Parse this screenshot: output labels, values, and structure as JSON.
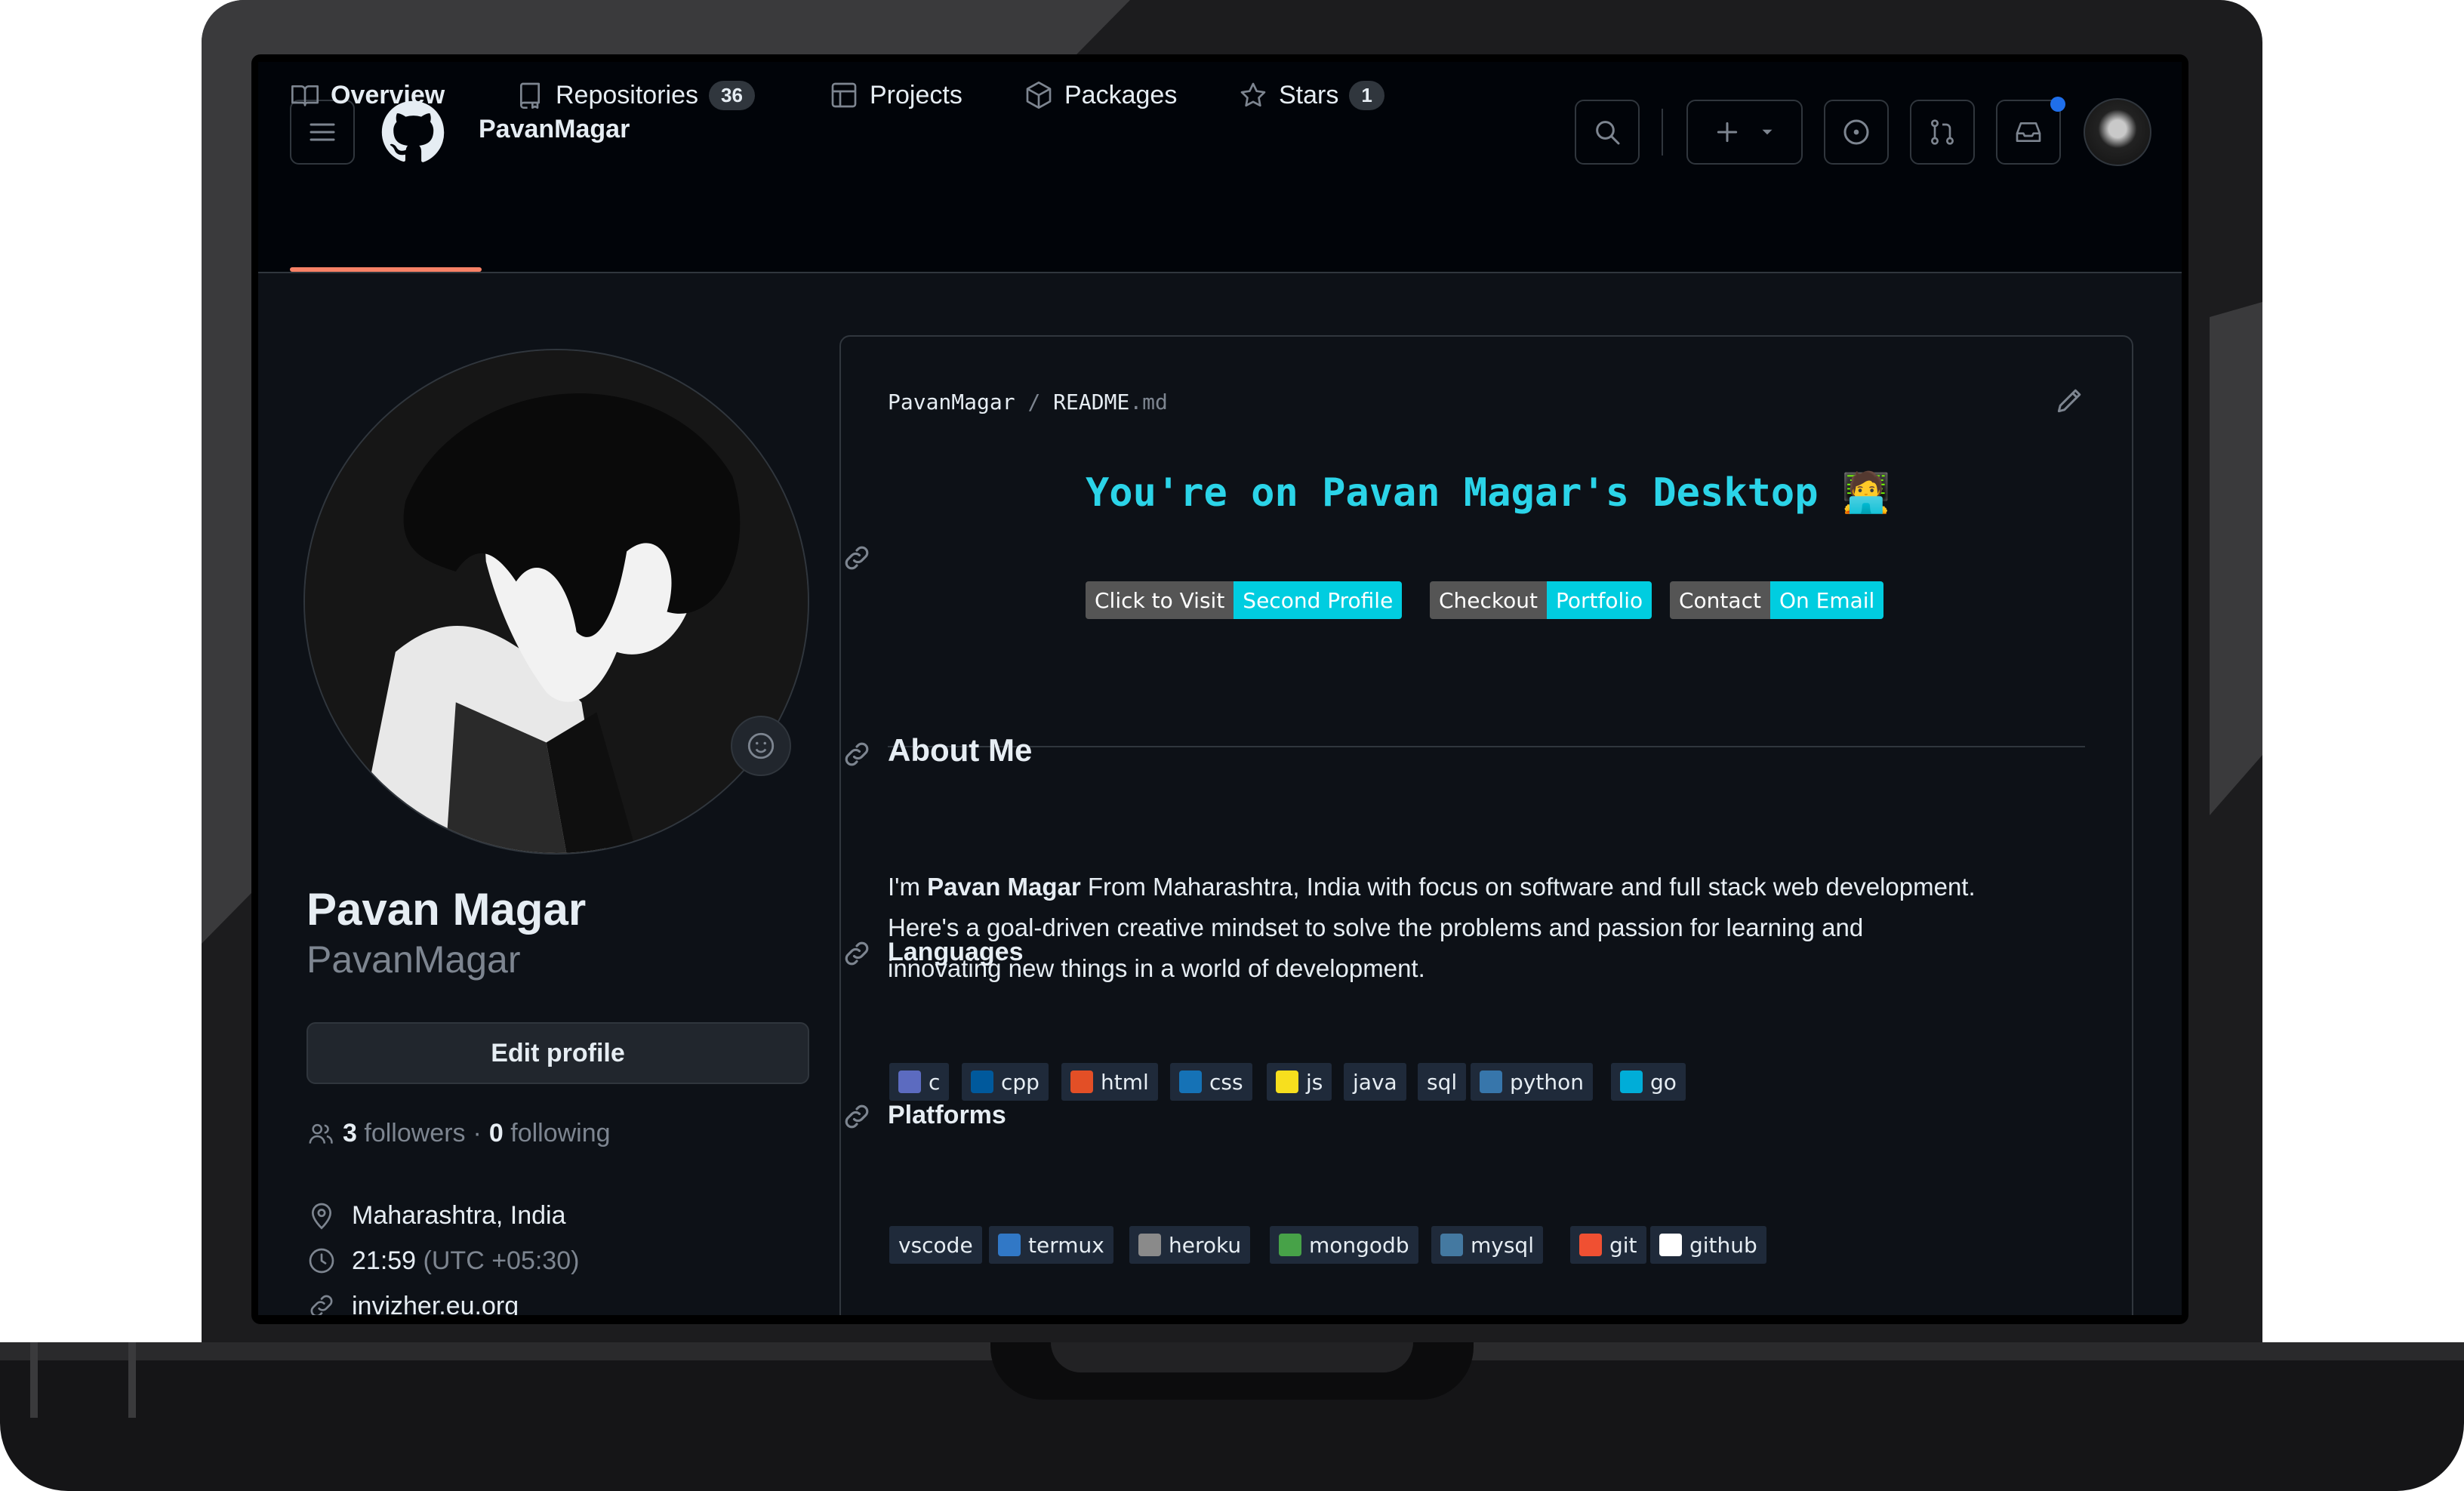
{
  "header": {
    "username": "PavanMagar"
  },
  "tabs": [
    {
      "label": "Overview"
    },
    {
      "label": "Repositories",
      "count": "36"
    },
    {
      "label": "Projects"
    },
    {
      "label": "Packages"
    },
    {
      "label": "Stars",
      "count": "1"
    }
  ],
  "profile": {
    "name": "Pavan Magar",
    "login": "PavanMagar",
    "edit_label": "Edit profile",
    "followers_count": "3",
    "followers_label": "followers",
    "separator": "·",
    "following_count": "0",
    "following_label": "following",
    "location": "Maharashtra, India",
    "time": "21:59",
    "timezone": "(UTC +05:30)",
    "website": "invizher.eu.org"
  },
  "readme": {
    "path_user": "PavanMagar",
    "path_sep": "/",
    "path_file": "README",
    "path_ext": ".md",
    "title": "You're on Pavan Magar's Desktop",
    "title_emoji": "🧑‍💻",
    "badges": [
      {
        "left": "Click to Visit",
        "right": "Second Profile"
      },
      {
        "left": "Checkout",
        "right": "Portfolio"
      },
      {
        "left": "Contact",
        "right": "On Email"
      }
    ],
    "about_heading": "About Me",
    "about_pre": "I'm ",
    "about_name": "Pavan Magar",
    "about_line1": " From Maharashtra, India with focus on software and full stack web development.",
    "about_line2": "Here's a goal-driven creative mindset to solve the problems and passion for learning and",
    "about_line3": "innovating new things in a world of development.",
    "languages_heading": "Languages",
    "languages": [
      {
        "label": "c",
        "color": "#5c6bc0"
      },
      {
        "label": "cpp",
        "color": "#00599c"
      },
      {
        "label": "html",
        "color": "#e34f26"
      },
      {
        "label": "css",
        "color": "#1572b6"
      },
      {
        "label": "js",
        "color": "#f7df1e"
      },
      {
        "label": "java",
        "color": ""
      },
      {
        "label": "sql",
        "color": ""
      },
      {
        "label": "python",
        "color": "#3776ab"
      },
      {
        "label": "go",
        "color": "#00add8"
      }
    ],
    "platforms_heading": "Platforms",
    "platforms": [
      {
        "label": "vscode",
        "color": ""
      },
      {
        "label": "termux",
        "color": "#3178c6"
      },
      {
        "label": "heroku",
        "color": "#8a8a8a"
      },
      {
        "label": "mongodb",
        "color": "#47a248"
      },
      {
        "label": "mysql",
        "color": "#4479a1"
      },
      {
        "label": "git",
        "color": "#f05032"
      },
      {
        "label": "github",
        "color": "#ffffff"
      }
    ]
  }
}
